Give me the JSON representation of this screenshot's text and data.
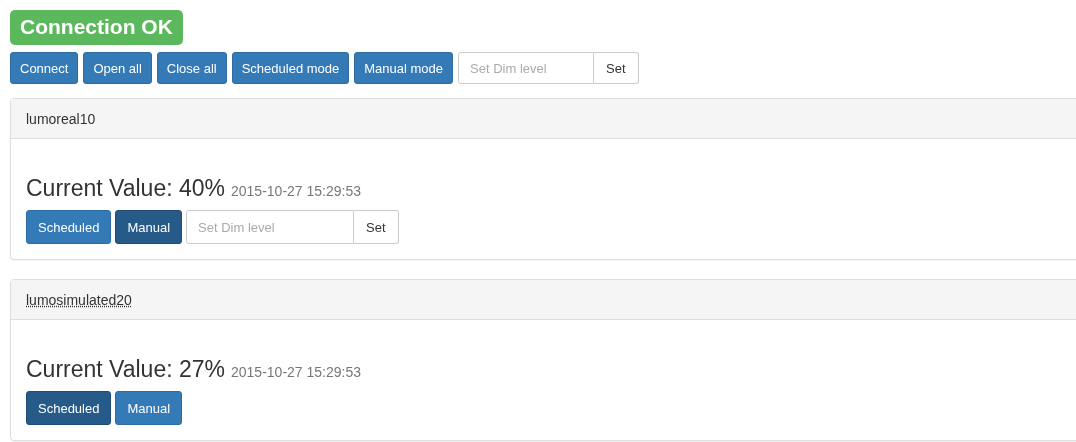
{
  "status_badge": "Connection OK",
  "toolbar": {
    "buttons": [
      "Connect",
      "Open all",
      "Close all",
      "Scheduled mode",
      "Manual mode"
    ],
    "dim_field": {
      "placeholder": "Set Dim level"
    },
    "set_button": "Set"
  },
  "devices": [
    {
      "name": "lumoreal10",
      "focused": false,
      "value_label": "Current Value: 40%",
      "timestamp": "2015-10-27 15:29:53",
      "modes": [
        {
          "label": "Scheduled",
          "selected": false
        },
        {
          "label": "Manual",
          "selected": true
        }
      ],
      "dim_field": {
        "placeholder": "Set Dim level"
      },
      "set_button": "Set"
    },
    {
      "name": "lumosimulated20",
      "focused": true,
      "value_label": "Current Value: 27%",
      "timestamp": "2015-10-27 15:29:53",
      "modes": [
        {
          "label": "Scheduled",
          "selected": true
        },
        {
          "label": "Manual",
          "selected": false
        }
      ]
    }
  ]
}
